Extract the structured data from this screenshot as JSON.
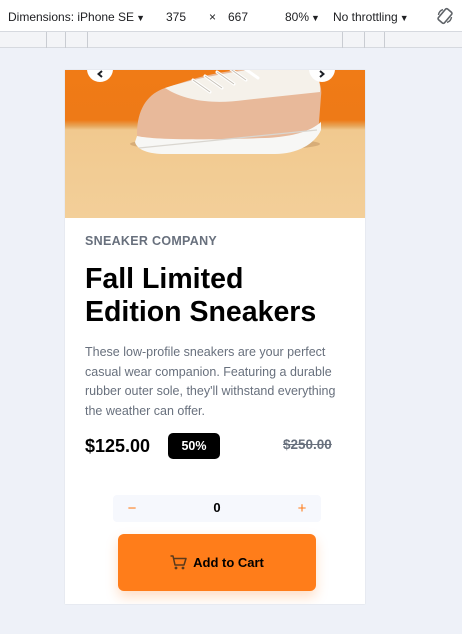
{
  "devtools": {
    "dimensions_label": "Dimensions: iPhone SE",
    "width": "375",
    "times": "×",
    "height": "667",
    "zoom": "80%",
    "throttling": "No throttling"
  },
  "product": {
    "company": "SNEAKER COMPANY",
    "title": "Fall Limited Edition Sneakers",
    "description": "These low-profile sneakers are your perfect casual wear companion. Featuring a durable rubber outer sole, they'll withstand everything the weather can offer.",
    "price": "$125.00",
    "discount": "50%",
    "old_price": "$250.00"
  },
  "cart": {
    "quantity": "0",
    "minus": "−",
    "plus": "+",
    "add_label": "Add to Cart"
  },
  "colors": {
    "accent": "#ff7d1a",
    "pale_accent": "#ffede0",
    "text_dark": "#000000",
    "text_grey": "#68707d",
    "quantity_bg": "#f6f8fd"
  },
  "icons": [
    "rotate-icon",
    "chevron-left-icon",
    "chevron-right-icon",
    "cart-icon",
    "minus-icon",
    "plus-icon"
  ]
}
